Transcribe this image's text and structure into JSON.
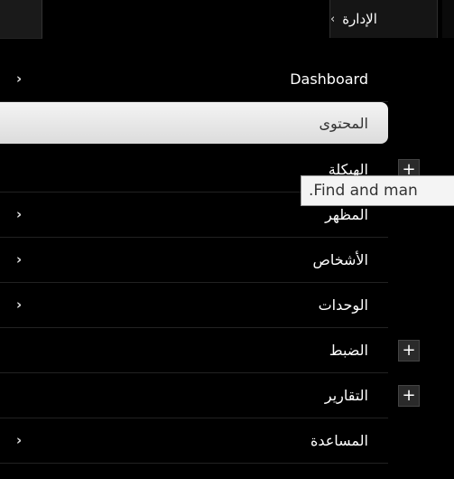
{
  "header": {
    "title": "الإدارة",
    "chevron_icon": "chevron-right-icon"
  },
  "menu": {
    "items": [
      {
        "label": "Dashboard",
        "arrow": "›"
      },
      {
        "label": "المحتوى",
        "active": true
      },
      {
        "label": "الهيكلة",
        "plus": "+"
      },
      {
        "label": "المظهر",
        "arrow": "›"
      },
      {
        "label": "الأشخاص",
        "arrow": "›"
      },
      {
        "label": "الوحدات",
        "arrow": "›"
      },
      {
        "label": "الضبط",
        "plus": "+"
      },
      {
        "label": "التقارير",
        "plus": "+"
      },
      {
        "label": "المساعدة",
        "arrow": "›"
      }
    ]
  },
  "tooltip": {
    "text": ".Find and man"
  }
}
